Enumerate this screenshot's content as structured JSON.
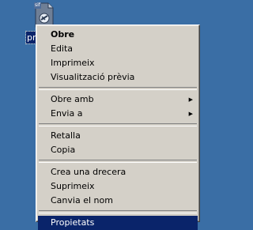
{
  "desktop": {
    "icon": {
      "ext_tag": "sif",
      "label": "pro"
    }
  },
  "menu": {
    "groups": [
      {
        "items": [
          {
            "label": "Obre",
            "bold": true
          },
          {
            "label": "Edita"
          },
          {
            "label": "Imprimeix"
          },
          {
            "label": "Visualització prèvia"
          }
        ]
      },
      {
        "items": [
          {
            "label": "Obre amb",
            "submenu": true
          },
          {
            "label": "Envia a",
            "submenu": true
          }
        ]
      },
      {
        "items": [
          {
            "label": "Retalla"
          },
          {
            "label": "Copia"
          }
        ]
      },
      {
        "items": [
          {
            "label": "Crea una drecera"
          },
          {
            "label": "Suprimeix"
          },
          {
            "label": "Canvia el nom"
          }
        ]
      },
      {
        "items": [
          {
            "label": "Propietats",
            "selected": true
          }
        ]
      }
    ],
    "submenu_icon": "triangle-right-icon"
  },
  "colors": {
    "desktop": "#3a6ea5",
    "menu_bg": "#d4d0c8",
    "highlight": "#0a246a",
    "highlight_text": "#ffffff"
  }
}
